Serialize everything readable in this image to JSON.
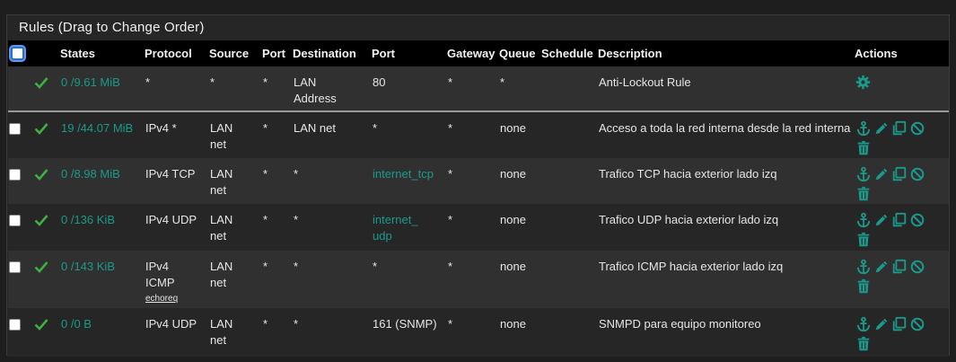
{
  "panel": {
    "title": "Rules (Drag to Change Order)"
  },
  "columns": {
    "states": "States",
    "protocol": "Protocol",
    "source": "Source",
    "port": "Port",
    "destination": "Destination",
    "dport": "Port",
    "gateway": "Gateway",
    "queue": "Queue",
    "schedule": "Schedule",
    "description": "Description",
    "actions": "Actions"
  },
  "colors": {
    "accent": "#1a9a8a",
    "header_bg": "#000000"
  },
  "rows": [
    {
      "states": "0 /9.61 MiB",
      "protocol": "*",
      "protocol_sub": "",
      "source1": "*",
      "source2": "",
      "sport": "*",
      "dest1": "LAN",
      "dest2": "Address",
      "dport1": "80",
      "dport2": "",
      "gateway": "*",
      "queue": "*",
      "schedule": "",
      "description": "Anti-Lockout Rule",
      "actions": [
        "gear-icon"
      ]
    },
    {
      "states": "19 /44.07 MiB",
      "protocol": "IPv4 *",
      "protocol_sub": "",
      "source1": "LAN",
      "source2": "net",
      "sport": "*",
      "dest1": "LAN net",
      "dest2": "",
      "dport1": "*",
      "dport2": "",
      "gateway": "*",
      "queue": "none",
      "schedule": "",
      "description": "Acceso a toda la red interna desde la red interna",
      "actions": [
        "anchor-icon",
        "pencil-icon",
        "copy-icon",
        "disable-icon",
        "trash-icon"
      ]
    },
    {
      "states": "0 /8.98 MiB",
      "protocol": "IPv4 TCP",
      "protocol_sub": "",
      "source1": "LAN",
      "source2": "net",
      "sport": "*",
      "dest1": "*",
      "dest2": "",
      "dport1": "internet_tcp",
      "dport2": "",
      "gateway": "*",
      "queue": "none",
      "schedule": "",
      "description": "Trafico TCP hacia exterior lado izq",
      "actions": [
        "anchor-icon",
        "pencil-icon",
        "copy-icon",
        "disable-icon",
        "trash-icon"
      ]
    },
    {
      "states": "0 /136 KiB",
      "protocol": "IPv4 UDP",
      "protocol_sub": "",
      "source1": "LAN",
      "source2": "net",
      "sport": "*",
      "dest1": "*",
      "dest2": "",
      "dport1": "internet_",
      "dport2": "udp",
      "gateway": "*",
      "queue": "none",
      "schedule": "",
      "description": "Trafico UDP hacia exterior lado izq",
      "actions": [
        "anchor-icon",
        "pencil-icon",
        "copy-icon",
        "disable-icon",
        "trash-icon"
      ]
    },
    {
      "states": "0 /143 KiB",
      "protocol": "IPv4",
      "protocol2": "ICMP",
      "protocol_sub": "echoreq",
      "source1": "LAN",
      "source2": "net",
      "sport": "*",
      "dest1": "*",
      "dest2": "",
      "dport1": "*",
      "dport2": "",
      "gateway": "*",
      "queue": "none",
      "schedule": "",
      "description": "Trafico ICMP hacia exterior lado izq",
      "actions": [
        "anchor-icon",
        "pencil-icon",
        "copy-icon",
        "disable-icon",
        "trash-icon"
      ]
    },
    {
      "states": "0 /0 B",
      "protocol": "IPv4 UDP",
      "protocol_sub": "",
      "source1": "LAN",
      "source2": "net",
      "sport": "*",
      "dest1": "*",
      "dest2": "",
      "dport1": "161 (SNMP)",
      "dport2": "",
      "gateway": "*",
      "queue": "none",
      "schedule": "",
      "description": "SNMPD para equipo monitoreo",
      "actions": [
        "anchor-icon",
        "pencil-icon",
        "copy-icon",
        "disable-icon",
        "trash-icon"
      ]
    }
  ]
}
